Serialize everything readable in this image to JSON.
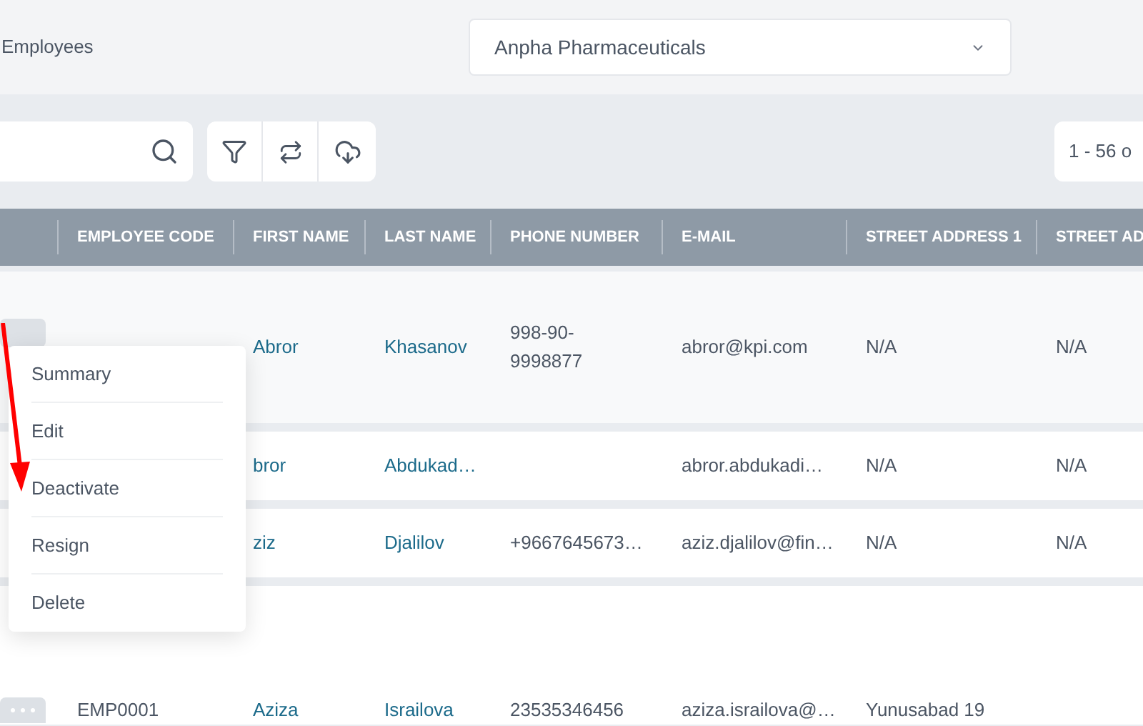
{
  "page_title": "Employees",
  "company_select": {
    "value": "Anpha Pharmaceuticals"
  },
  "pagination": "1 - 56 o",
  "table": {
    "columns": [
      "EMPLOYEE CODE",
      "FIRST NAME",
      "LAST NAME",
      "PHONE NUMBER",
      "E-MAIL",
      "STREET ADDRESS 1",
      "STREET AD"
    ],
    "rows": [
      {
        "kind": "tall",
        "first_name": "Abror",
        "last_name": "Khasanov",
        "phone": "998-90-9998877",
        "email": "abror@kpi.com",
        "street_address_1": "N/A",
        "column_7": "N/A"
      },
      {
        "kind": "short",
        "first_name": "bror",
        "last_name": "Abdukad…",
        "email": "abror.abdukadi…",
        "street_address_1": "N/A",
        "column_7": "N/A"
      },
      {
        "kind": "short",
        "first_name": "ziz",
        "last_name": "Djalilov",
        "phone": "+9667645673…",
        "email": "aziz.djalilov@fin…",
        "street_address_1": "N/A",
        "column_7": "N/A"
      },
      {
        "kind": "bottom",
        "employee_code": "EMP0001",
        "first_name": "Aziza",
        "last_name": "Israilova",
        "phone": "23535346456",
        "email": "aziza.israilova@…",
        "street_address_1": "Yunusabad 19"
      }
    ]
  },
  "context_menu": {
    "items": [
      "Summary",
      "Edit",
      "Deactivate",
      "Resign",
      "Delete"
    ]
  }
}
